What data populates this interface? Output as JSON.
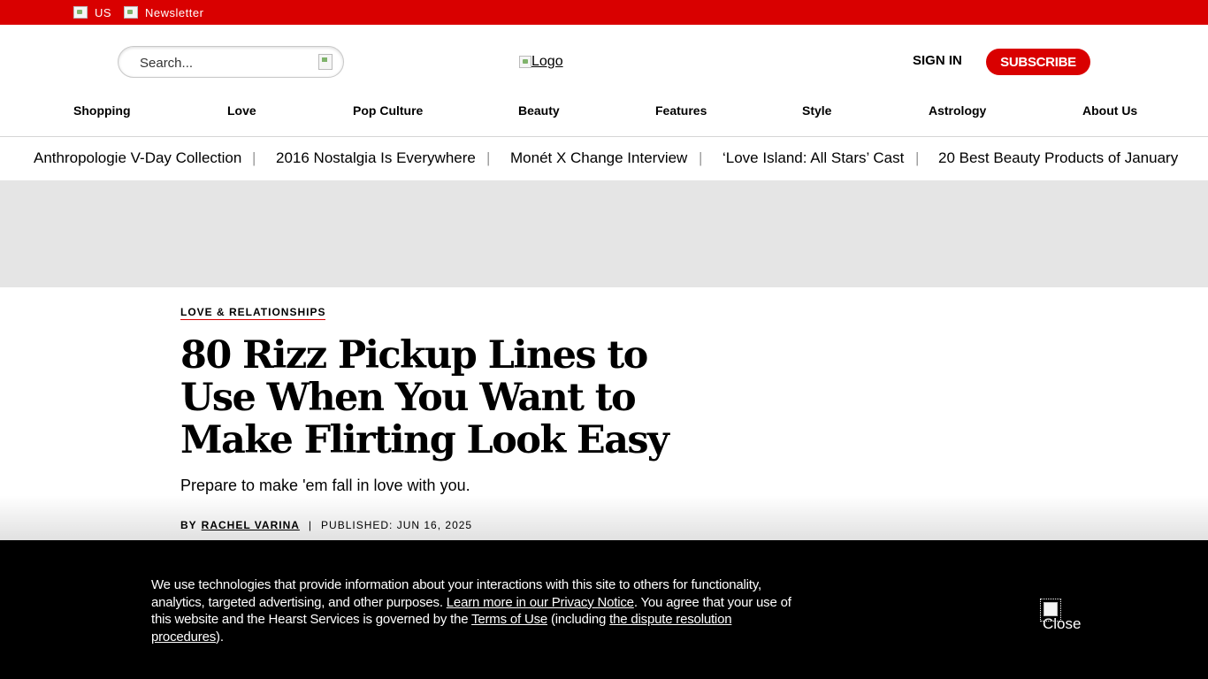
{
  "topbar": {
    "region_label": "US",
    "newsletter_label": "Newsletter"
  },
  "header": {
    "search_placeholder": "Search...",
    "logo_alt": "Logo",
    "signin_label": "SIGN IN",
    "subscribe_label": "SUBSCRIBE"
  },
  "nav": {
    "items": [
      "Shopping",
      "Love",
      "Pop Culture",
      "Beauty",
      "Features",
      "Style",
      "Astrology",
      "About Us"
    ]
  },
  "trending": {
    "items": [
      "Anthropologie V-Day Collection",
      "2016 Nostalgia Is Everywhere",
      "Monét X Change Interview",
      "‘Love Island: All Stars’ Cast",
      "20 Best Beauty Products of January"
    ],
    "separator": "|"
  },
  "article": {
    "category": "LOVE & RELATIONSHIPS",
    "headline": "80 Rizz Pickup Lines to Use When You Want to Make Flirting Look Easy",
    "dek": "Prepare to make 'em fall in love with you.",
    "byline_prefix": "BY",
    "author": "RACHEL VARINA",
    "byline_separator": "|",
    "published": "PUBLISHED: JUN 16, 2025"
  },
  "cookie_banner": {
    "text_1": "We use technologies that provide information about your interactions with this site to others for functionality, analytics, targeted advertising, and other purposes. ",
    "privacy_link": "Learn more in our Privacy Notice",
    "text_2": ". You agree that your use of this website and the Hearst Services is governed by the ",
    "terms_link": "Terms of Use",
    "text_3": " (including ",
    "dispute_link": "the dispute resolution procedures",
    "text_4": ").",
    "close_label": "Close"
  },
  "colors": {
    "brand_red": "#d90000",
    "ad_gray": "#e5e5e5",
    "banner_black": "#000000"
  }
}
